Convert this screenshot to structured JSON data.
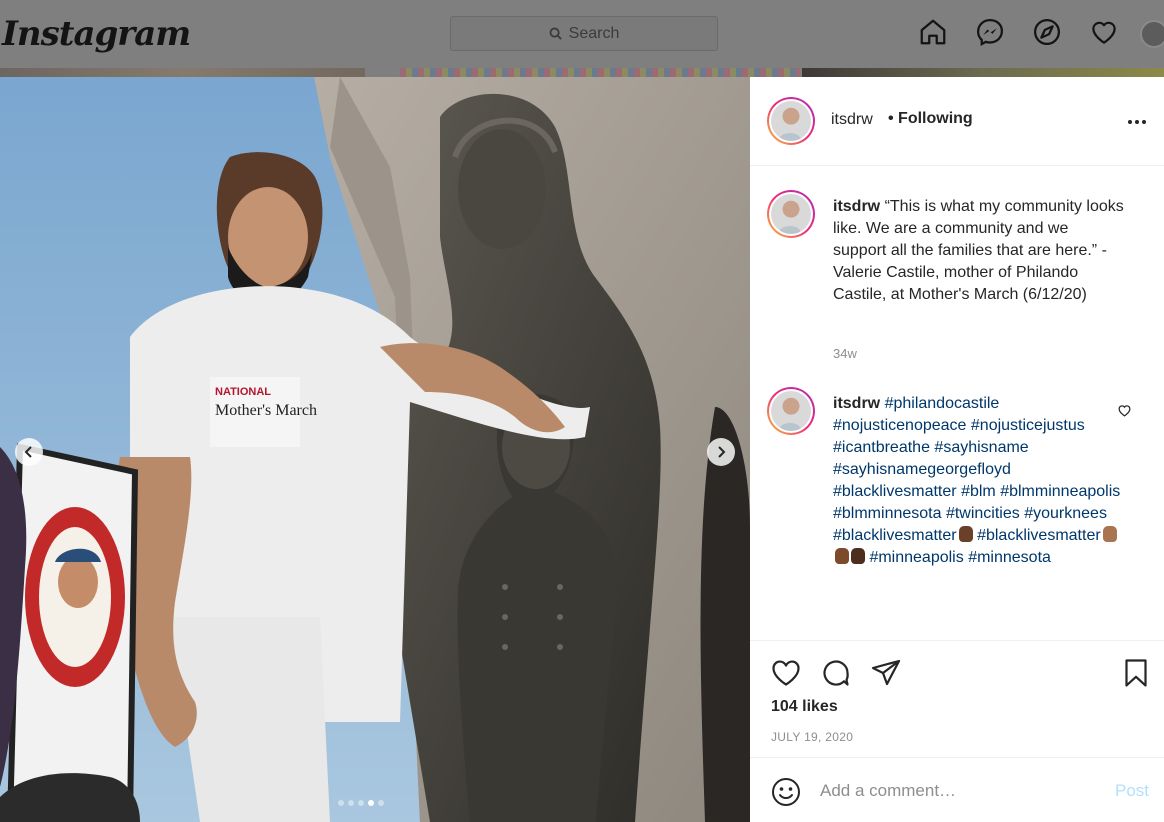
{
  "app": {
    "logo_text": "Instagram",
    "search_placeholder": "Search"
  },
  "nav": {
    "icons": [
      "home-icon",
      "messenger-icon",
      "explore-icon",
      "activity-heart-icon",
      "profile-avatar"
    ]
  },
  "carousel": {
    "image_count": 5,
    "active_index": 3,
    "description_icons": [
      "chevron-left-icon",
      "chevron-right-icon"
    ]
  },
  "post": {
    "username": "itsdrw",
    "follow_status": "Following",
    "likes": "104 likes",
    "date": "JULY 19, 2020",
    "comment_placeholder": "Add a comment…",
    "post_label": "Post"
  },
  "caption": {
    "username": "itsdrw",
    "text": "“This is what my community looks like. We are a community and we support all the families that are here.” - Valerie Castile, mother of Philando Castile, at Mother's March (6/12/20)",
    "age": "34w"
  },
  "comment": {
    "username": "itsdrw",
    "tags": [
      "#philandocastile",
      "#nojusticenopeace",
      "#nojusticejustus",
      "#icantbreathe",
      "#sayhisname",
      "#sayhisnamegeorgefloyd",
      "#blacklivesmatter",
      "#blm",
      "#blmminneapolis",
      "#blmminnesota",
      "#twincities",
      "#yourknees",
      "#blacklivesmatter",
      "#blacklivesmatter",
      "#minneapolis",
      "#minnesota"
    ],
    "emoji_colors": [
      "#6b4028",
      "#a87550",
      "#7c4b2c",
      "#4d2e1e"
    ]
  },
  "colors": {
    "link": "#00376b",
    "muted": "#8e8e8e",
    "post_button_disabled": "#b2dffc"
  }
}
